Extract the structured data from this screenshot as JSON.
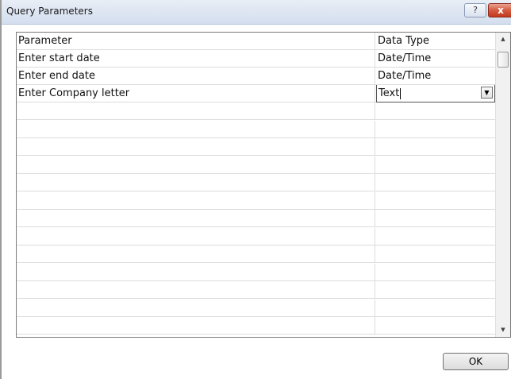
{
  "window": {
    "title": "Query Parameters",
    "help_label": "?",
    "close_label": "x"
  },
  "grid": {
    "headers": {
      "parameter": "Parameter",
      "data_type": "Data Type"
    },
    "rows": [
      {
        "parameter": "Enter start date",
        "data_type": "Date/Time"
      },
      {
        "parameter": "Enter end date",
        "data_type": "Date/Time"
      },
      {
        "parameter": "Enter Company letter",
        "data_type": "Text"
      }
    ],
    "empty_rows": 13,
    "active_row": 2
  },
  "scrollbar": {
    "up_icon": "scroll-up-arrow-icon",
    "down_icon": "scroll-down-arrow-icon"
  },
  "dropdown": {
    "icon": "chevron-down-icon"
  },
  "buttons": {
    "ok_label": "OK"
  }
}
